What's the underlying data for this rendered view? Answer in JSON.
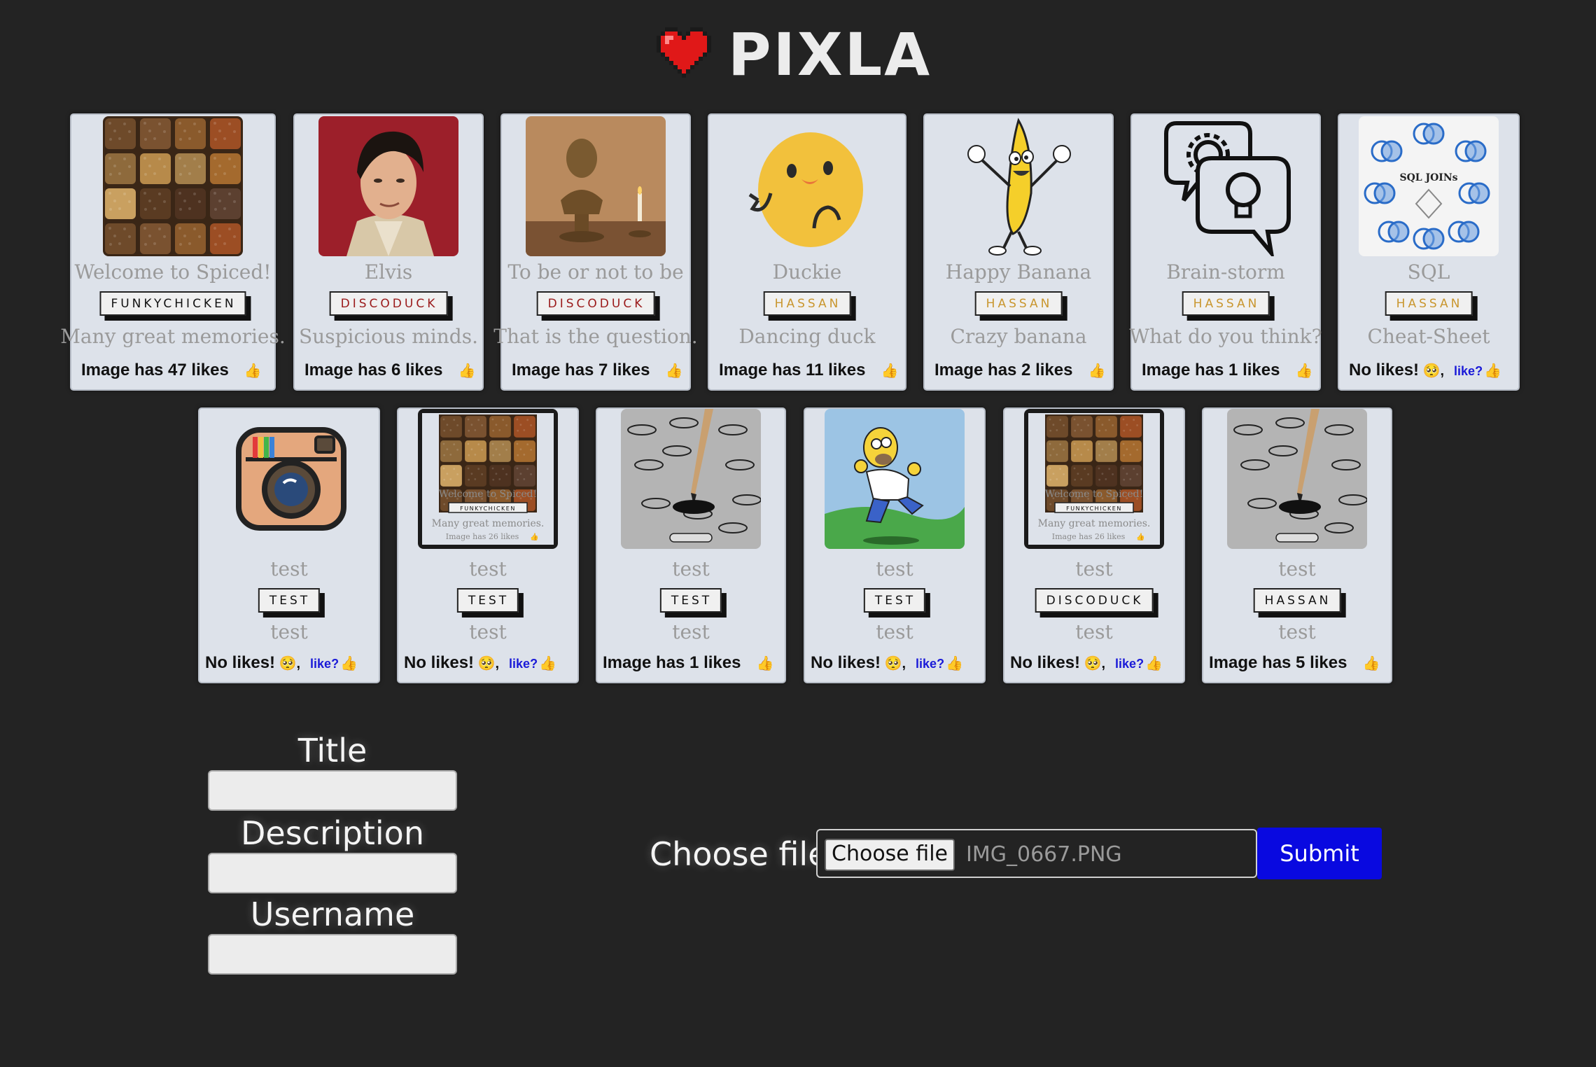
{
  "header": {
    "logo_text": "PIXLA",
    "logo_icon": "pixel-heart-icon"
  },
  "colors": {
    "background": "#232323",
    "card": "#dde2ea",
    "submit": "#0909e0",
    "funky": "#111111",
    "discoduck": "#9b1b1b",
    "hassan": "#c9962e",
    "test": "#111111"
  },
  "gallery": {
    "row1": [
      {
        "title": "Welcome to Spiced!",
        "username": "FUNKYCHICKEN",
        "user_color": "#111111",
        "description": "Many great memories.",
        "likes": "Image has 47 likes",
        "like_link": "",
        "image": "spices"
      },
      {
        "title": "Elvis",
        "username": "DISCODUCK",
        "user_color": "#9b1b1b",
        "description": "Suspicious minds.",
        "likes": "Image has 6 likes",
        "like_link": "",
        "image": "elvis"
      },
      {
        "title": "To be or not to be",
        "username": "DISCODUCK",
        "user_color": "#9b1b1b",
        "description": "That is the question.",
        "likes": "Image has 7 likes",
        "like_link": "",
        "image": "bust"
      },
      {
        "title": "Duckie",
        "username": "HASSAN",
        "user_color": "#c9962e",
        "description": "Dancing duck",
        "likes": "Image has 11 likes",
        "like_link": "",
        "image": "duck"
      },
      {
        "title": "Happy Banana",
        "username": "HASSAN",
        "user_color": "#c9962e",
        "description": "Crazy banana",
        "likes": "Image has 2 likes",
        "like_link": "",
        "image": "banana"
      },
      {
        "title": "Brain-storm",
        "username": "HASSAN",
        "user_color": "#c9962e",
        "description": "What do you think?",
        "likes": "Image has 1 likes",
        "like_link": "",
        "image": "brainstorm"
      },
      {
        "title": "SQL",
        "username": "HASSAN",
        "user_color": "#c9962e",
        "description": "Cheat-Sheet",
        "likes": "No likes!",
        "like_link": "like?",
        "image": "sql"
      }
    ],
    "row2": [
      {
        "title": "test",
        "username": "TEST",
        "user_color": "#111111",
        "description": "test",
        "likes": "No likes!",
        "like_link": "like?",
        "image": "instagram"
      },
      {
        "title": "test",
        "username": "TEST",
        "user_color": "#111111",
        "description": "test",
        "likes": "No likes!",
        "like_link": "like?",
        "image": "screenshot"
      },
      {
        "title": "test",
        "username": "TEST",
        "user_color": "#111111",
        "description": "test",
        "likes": "Image has 1 likes",
        "like_link": "",
        "image": "bubblesheet"
      },
      {
        "title": "test",
        "username": "TEST",
        "user_color": "#111111",
        "description": "test",
        "likes": "No likes!",
        "like_link": "like?",
        "image": "homer"
      },
      {
        "title": "test",
        "username": "DISCODUCK",
        "user_color": "#111111",
        "description": "test",
        "likes": "No likes!",
        "like_link": "like?",
        "image": "screenshot"
      },
      {
        "title": "test",
        "username": "HASSAN",
        "user_color": "#111111",
        "description": "test",
        "likes": "Image has 5 likes",
        "like_link": "",
        "image": "bubblesheet"
      }
    ],
    "screenshot_texts": {
      "title": "Welcome to Spiced!",
      "username": "FUNKYCHICKEN",
      "description": "Many great memories.",
      "likes": "Image has 26 likes"
    },
    "sql_title": "SQL JOINs"
  },
  "form": {
    "title_label": "Title",
    "description_label": "Description",
    "username_label": "Username",
    "title_value": "",
    "description_value": "",
    "username_value": "",
    "file_label": "Choose file",
    "file_button": "Choose file",
    "file_name": "IMG_0667.PNG",
    "submit_label": "Submit"
  }
}
